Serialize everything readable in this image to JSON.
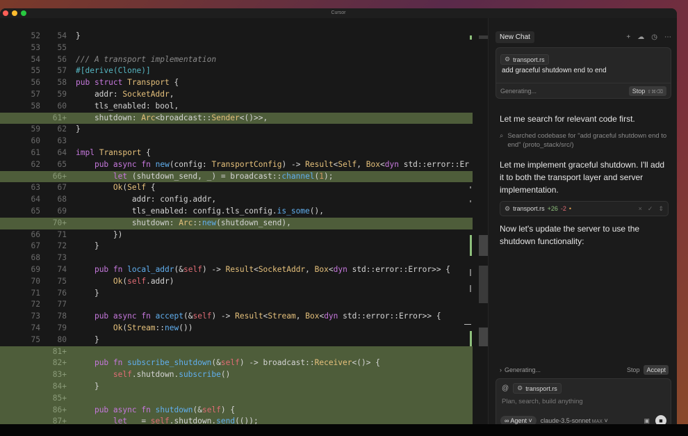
{
  "window": {
    "title": "Cursor"
  },
  "editor": {
    "lines": [
      {
        "old": "52",
        "new": "54",
        "added": false,
        "code": "}"
      },
      {
        "old": "53",
        "new": "55",
        "added": false,
        "code": ""
      },
      {
        "old": "54",
        "new": "56",
        "added": false,
        "code": "/// A transport implementation"
      },
      {
        "old": "55",
        "new": "57",
        "added": false,
        "code": "#[derive(Clone)]"
      },
      {
        "old": "56",
        "new": "58",
        "added": false,
        "code": "pub struct Transport {"
      },
      {
        "old": "57",
        "new": "59",
        "added": false,
        "code": "    addr: SocketAddr,"
      },
      {
        "old": "58",
        "new": "60",
        "added": false,
        "code": "    tls_enabled: bool,"
      },
      {
        "old": "",
        "new": "61+",
        "added": true,
        "code": "    shutdown: Arc<broadcast::Sender<()>>,"
      },
      {
        "old": "59",
        "new": "62",
        "added": false,
        "code": "}"
      },
      {
        "old": "60",
        "new": "63",
        "added": false,
        "code": ""
      },
      {
        "old": "61",
        "new": "64",
        "added": false,
        "code": "impl Transport {"
      },
      {
        "old": "62",
        "new": "65",
        "added": false,
        "code": "    pub async fn new(config: TransportConfig) -> Result<Self, Box<dyn std::error::Er"
      },
      {
        "old": "",
        "new": "66+",
        "added": true,
        "code": "        let (shutdown_send, _) = broadcast::channel(1);"
      },
      {
        "old": "63",
        "new": "67",
        "added": false,
        "code": "        Ok(Self {"
      },
      {
        "old": "64",
        "new": "68",
        "added": false,
        "code": "            addr: config.addr,"
      },
      {
        "old": "65",
        "new": "69",
        "added": false,
        "code": "            tls_enabled: config.tls_config.is_some(),"
      },
      {
        "old": "",
        "new": "70+",
        "added": true,
        "code": "            shutdown: Arc::new(shutdown_send),"
      },
      {
        "old": "66",
        "new": "71",
        "added": false,
        "code": "        })"
      },
      {
        "old": "67",
        "new": "72",
        "added": false,
        "code": "    }"
      },
      {
        "old": "68",
        "new": "73",
        "added": false,
        "code": ""
      },
      {
        "old": "69",
        "new": "74",
        "added": false,
        "code": "    pub fn local_addr(&self) -> Result<SocketAddr, Box<dyn std::error::Error>> {"
      },
      {
        "old": "70",
        "new": "75",
        "added": false,
        "code": "        Ok(self.addr)"
      },
      {
        "old": "71",
        "new": "76",
        "added": false,
        "code": "    }"
      },
      {
        "old": "72",
        "new": "77",
        "added": false,
        "code": ""
      },
      {
        "old": "73",
        "new": "78",
        "added": false,
        "code": "    pub async fn accept(&self) -> Result<Stream, Box<dyn std::error::Error>> {"
      },
      {
        "old": "74",
        "new": "79",
        "added": false,
        "code": "        Ok(Stream::new())"
      },
      {
        "old": "75",
        "new": "80",
        "added": false,
        "code": "    }"
      },
      {
        "old": "",
        "new": "81+",
        "added": true,
        "code": ""
      },
      {
        "old": "",
        "new": "82+",
        "added": true,
        "code": "    pub fn subscribe_shutdown(&self) -> broadcast::Receiver<()> {"
      },
      {
        "old": "",
        "new": "83+",
        "added": true,
        "code": "        self.shutdown.subscribe()"
      },
      {
        "old": "",
        "new": "84+",
        "added": true,
        "code": "    }"
      },
      {
        "old": "",
        "new": "85+",
        "added": true,
        "code": ""
      },
      {
        "old": "",
        "new": "86+",
        "added": true,
        "code": "    pub async fn shutdown(&self) {"
      },
      {
        "old": "",
        "new": "87+",
        "added": true,
        "code": "        let _ = self.shutdown.send(());"
      }
    ]
  },
  "sidebar": {
    "tab_label": "New Chat",
    "header_icons": [
      "plus-icon",
      "cloud-icon",
      "history-icon",
      "more-icon"
    ],
    "input_card": {
      "file_chip": "transport.rs",
      "prompt": "add graceful shutdown end to end",
      "status": "Generating...",
      "stop_label": "Stop",
      "stop_shortcut": "⇧⌘⌫"
    },
    "messages": {
      "m1": "Let me search for relevant code first.",
      "search_note": "Searched codebase for \"add graceful shutdown end to end\" (proto_stack/src/)",
      "m2": "Let me implement graceful shutdown. I'll add it to both the transport layer and server implementation.",
      "m3": "Now let's update the server to use the shutdown functionality:"
    },
    "file_change": {
      "name": "transport.rs",
      "added": "+26",
      "removed": "-2",
      "marker": "•"
    },
    "gen_bar": {
      "label": "Generating...",
      "stop": "Stop",
      "accept": "Accept"
    },
    "composer": {
      "file_chip": "transport.rs",
      "placeholder": "Plan, search, build anything",
      "mode": "Agent",
      "model": "claude-3.5-sonnet",
      "max_label": "MAX"
    }
  }
}
